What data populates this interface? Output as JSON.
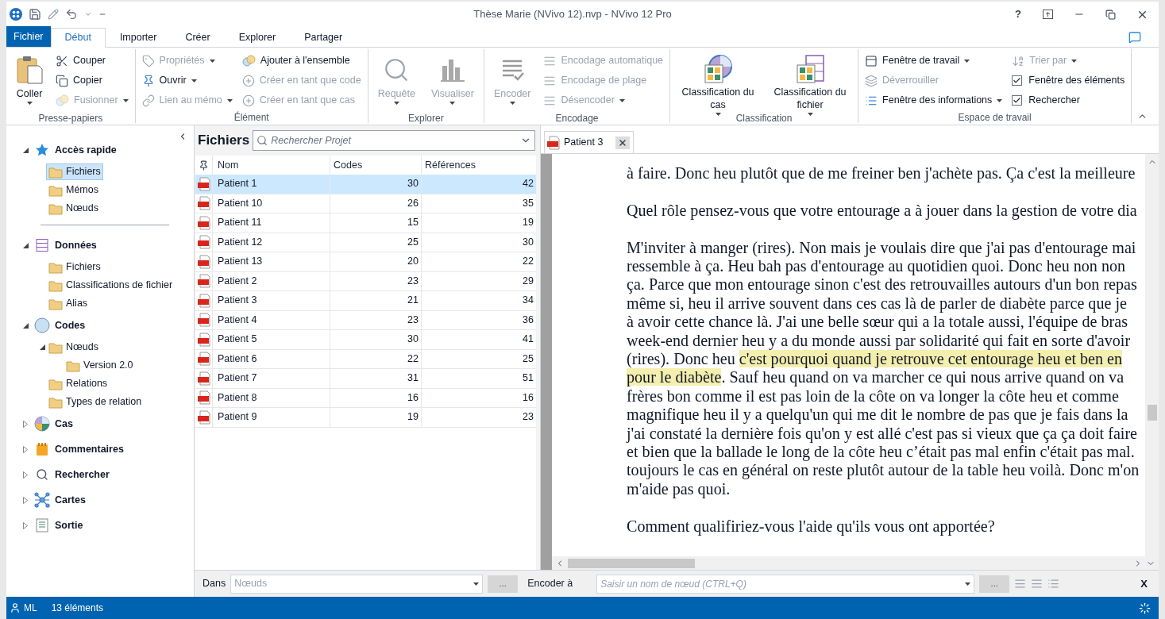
{
  "window": {
    "title": "Thèse Marie (NVivo 12).nvp - NVivo 12 Pro",
    "help": "?"
  },
  "ribbon_tabs": [
    {
      "label": "Fichier",
      "kind": "file",
      "selected": false
    },
    {
      "label": "Début",
      "kind": "tab",
      "selected": true
    },
    {
      "label": "Importer",
      "kind": "tab",
      "selected": false
    },
    {
      "label": "Créer",
      "kind": "tab",
      "selected": false
    },
    {
      "label": "Explorer",
      "kind": "tab",
      "selected": false
    },
    {
      "label": "Partager",
      "kind": "tab",
      "selected": false
    }
  ],
  "ribbon_groups": [
    {
      "label": "Presse-papiers",
      "columns": [
        [
          {
            "kind": "large",
            "label": "Coller",
            "dropdown": true,
            "disabled": false
          }
        ],
        [
          {
            "kind": "small",
            "label": "Couper",
            "dropdown": false,
            "disabled": false
          },
          {
            "kind": "small",
            "label": "Copier",
            "dropdown": false,
            "disabled": false
          },
          {
            "kind": "small",
            "label": "Fusionner",
            "dropdown": true,
            "disabled": true
          }
        ]
      ]
    },
    {
      "label": "Élément",
      "columns": [
        [
          {
            "kind": "small",
            "label": "Propriétés",
            "dropdown": true,
            "disabled": true
          },
          {
            "kind": "small",
            "label": "Ouvrir",
            "dropdown": true,
            "disabled": false
          },
          {
            "kind": "small",
            "label": "Lien au mémo",
            "dropdown": true,
            "disabled": true
          }
        ],
        [
          {
            "kind": "small",
            "label": "Ajouter à l'ensemble",
            "dropdown": false,
            "disabled": false
          },
          {
            "kind": "small",
            "label": "Créer en tant que code",
            "dropdown": false,
            "disabled": true
          },
          {
            "kind": "small",
            "label": "Créer en tant que cas",
            "dropdown": false,
            "disabled": true
          }
        ]
      ]
    },
    {
      "label": "Explorer",
      "columns": [
        [
          {
            "kind": "large",
            "label": "Requête",
            "dropdown": true,
            "disabled": true
          }
        ],
        [
          {
            "kind": "large",
            "label": "Visualiser",
            "dropdown": true,
            "disabled": true
          }
        ]
      ]
    },
    {
      "label": "Encodage",
      "columns": [
        [
          {
            "kind": "large",
            "label": "Encoder",
            "dropdown": true,
            "disabled": true
          }
        ],
        [
          {
            "kind": "small",
            "label": "Encodage automatique",
            "dropdown": false,
            "disabled": true
          },
          {
            "kind": "small",
            "label": "Encodage de plage",
            "dropdown": false,
            "disabled": true
          },
          {
            "kind": "small",
            "label": "Désencoder",
            "dropdown": true,
            "disabled": true
          }
        ]
      ]
    },
    {
      "label": "Classification",
      "columns": [
        [
          {
            "kind": "large",
            "label": "Classification du cas",
            "dropdown": true,
            "disabled": false
          }
        ],
        [
          {
            "kind": "large",
            "label": "Classification du fichier",
            "dropdown": true,
            "disabled": false
          }
        ]
      ]
    },
    {
      "label": "Espace de travail",
      "columns": [
        [
          {
            "kind": "small",
            "label": "Fenêtre de travail",
            "dropdown": true,
            "disabled": false
          },
          {
            "kind": "small",
            "label": "Déverrouiller",
            "dropdown": false,
            "disabled": true
          },
          {
            "kind": "small",
            "label": "Fenêtre des informations",
            "dropdown": true,
            "disabled": false
          }
        ],
        [
          {
            "kind": "small",
            "label": "Trier par",
            "dropdown": true,
            "disabled": true
          },
          {
            "kind": "checkbox",
            "label": "Fenêtre des éléments",
            "checked": true
          },
          {
            "kind": "checkbox",
            "label": "Rechercher",
            "checked": true
          }
        ]
      ]
    }
  ],
  "navigation": [
    {
      "label": "Accès rapide",
      "expanded": true,
      "children": [
        {
          "label": "Fichiers",
          "selected": true
        },
        {
          "label": "Mémos",
          "selected": false
        },
        {
          "label": "Nœuds",
          "selected": false
        }
      ]
    },
    {
      "label": "Données",
      "expanded": true,
      "children": [
        {
          "label": "Fichiers",
          "selected": false
        },
        {
          "label": "Classifications de fichier",
          "selected": false
        },
        {
          "label": "Alias",
          "selected": false
        }
      ]
    },
    {
      "label": "Codes",
      "expanded": true,
      "children": [
        {
          "label": "Nœuds",
          "selected": false,
          "expanded": true,
          "children": [
            {
              "label": "Version 2.0",
              "selected": false
            }
          ]
        },
        {
          "label": "Relations",
          "selected": false
        },
        {
          "label": "Types de relation",
          "selected": false
        }
      ]
    },
    {
      "label": "Cas",
      "expanded": false
    },
    {
      "label": "Commentaires",
      "expanded": false
    },
    {
      "label": "Rechercher",
      "expanded": false
    },
    {
      "label": "Cartes",
      "expanded": false
    },
    {
      "label": "Sortie",
      "expanded": false
    }
  ],
  "list_view": {
    "title": "Fichiers",
    "search": {
      "placeholder": "Rechercher Projet"
    },
    "columns": [
      "Nom",
      "Codes",
      "Références"
    ],
    "rows": [
      {
        "name": "Patient 1",
        "codes": "30",
        "references": "42",
        "selected": true
      },
      {
        "name": "Patient 10",
        "codes": "26",
        "references": "35",
        "selected": false
      },
      {
        "name": "Patient 11",
        "codes": "15",
        "references": "19",
        "selected": false
      },
      {
        "name": "Patient 12",
        "codes": "25",
        "references": "30",
        "selected": false
      },
      {
        "name": "Patient 13",
        "codes": "20",
        "references": "22",
        "selected": false
      },
      {
        "name": "Patient 2",
        "codes": "23",
        "references": "29",
        "selected": false
      },
      {
        "name": "Patient 3",
        "codes": "21",
        "references": "34",
        "selected": false
      },
      {
        "name": "Patient 4",
        "codes": "23",
        "references": "36",
        "selected": false
      },
      {
        "name": "Patient 5",
        "codes": "30",
        "references": "41",
        "selected": false
      },
      {
        "name": "Patient 6",
        "codes": "22",
        "references": "25",
        "selected": false
      },
      {
        "name": "Patient 7",
        "codes": "31",
        "references": "51",
        "selected": false
      },
      {
        "name": "Patient 8",
        "codes": "16",
        "references": "16",
        "selected": false
      },
      {
        "name": "Patient 9",
        "codes": "19",
        "references": "23",
        "selected": false
      }
    ]
  },
  "document": {
    "tab": {
      "label": "Patient 3",
      "selected": true
    },
    "paragraphs": [
      {
        "lines": [
          {
            "segments": [
              {
                "text": "à faire. Donc heu plutôt que de me freiner ben j'achète pas. Ça c'est la meilleure",
                "highlighted": false
              }
            ]
          }
        ]
      },
      {
        "lines": [
          {
            "segments": [
              {
                "text": "Quel rôle pensez-vous que votre entourage a à jouer dans la gestion de votre dia",
                "highlighted": false
              }
            ]
          }
        ]
      },
      {
        "lines": [
          {
            "segments": [
              {
                "text": "M'inviter à manger (rires). Non mais je voulais dire que j'ai pas d'entourage mai",
                "highlighted": false
              }
            ]
          },
          {
            "segments": [
              {
                "text": "ressemble à ça. Heu bah pas d'entourage au quotidien quoi. Donc heu non non",
                "highlighted": false
              }
            ]
          },
          {
            "segments": [
              {
                "text": "ça. Parce que mon entourage sinon c'est des retrouvailles autours d'un bon repas",
                "highlighted": false
              }
            ]
          },
          {
            "segments": [
              {
                "text": "même si, heu il arrive souvent dans ces cas là de parler de diabète parce que je",
                "highlighted": false
              }
            ]
          },
          {
            "segments": [
              {
                "text": "à avoir cette chance là. J'ai une belle sœur qui a la totale aussi, l'équipe de bras",
                "highlighted": false
              }
            ]
          },
          {
            "segments": [
              {
                "text": "week-end dernier heu y a du monde aussi par solidarité qui fait en sorte d'avoir",
                "highlighted": false
              }
            ]
          },
          {
            "segments": [
              {
                "text": "(rires). Donc heu ",
                "highlighted": false
              },
              {
                "text": "c'est pourquoi quand je retrouve cet entourage heu et ben en",
                "highlighted": true
              }
            ]
          },
          {
            "segments": [
              {
                "text": "pour le diabète",
                "highlighted": true
              },
              {
                "text": ". Sauf heu quand on va marcher ce qui nous arrive quand on va",
                "highlighted": false
              }
            ]
          },
          {
            "segments": [
              {
                "text": "frères bon comme il est pas loin de la côte on va longer la côte heu et comme",
                "highlighted": false
              }
            ]
          },
          {
            "segments": [
              {
                "text": "magnifique heu il y a quelqu'un qui me dit le nombre de pas que je fais dans la",
                "highlighted": false
              }
            ]
          },
          {
            "segments": [
              {
                "text": "j'ai constaté la dernière fois qu'on y est allé c'est pas si vieux que ça ça doit faire",
                "highlighted": false
              }
            ]
          },
          {
            "segments": [
              {
                "text": "et bien que la ballade le long de la côte heu c’était pas mal enfin c'était pas mal.",
                "highlighted": false
              }
            ]
          },
          {
            "segments": [
              {
                "text": "toujours le cas en général on reste plutôt autour de la table heu voilà. Donc m'on",
                "highlighted": false
              }
            ]
          },
          {
            "segments": [
              {
                "text": "m'aide pas quoi.",
                "highlighted": false
              }
            ]
          }
        ]
      },
      {
        "lines": [
          {
            "segments": [
              {
                "text": "Comment qualifiriez-vous l'aide qu'ils vous ont apportée?",
                "highlighted": false
              }
            ]
          }
        ]
      }
    ]
  },
  "coding_bar": {
    "in_label": "Dans",
    "in_value": "Nœuds",
    "in_button": "...",
    "code_label": "Encoder à",
    "code_placeholder": "Saisir un nom de nœud (CTRL+Q)",
    "code_button": "...",
    "close": "X"
  },
  "status_bar": {
    "user": "ML",
    "count": "13 éléments"
  }
}
